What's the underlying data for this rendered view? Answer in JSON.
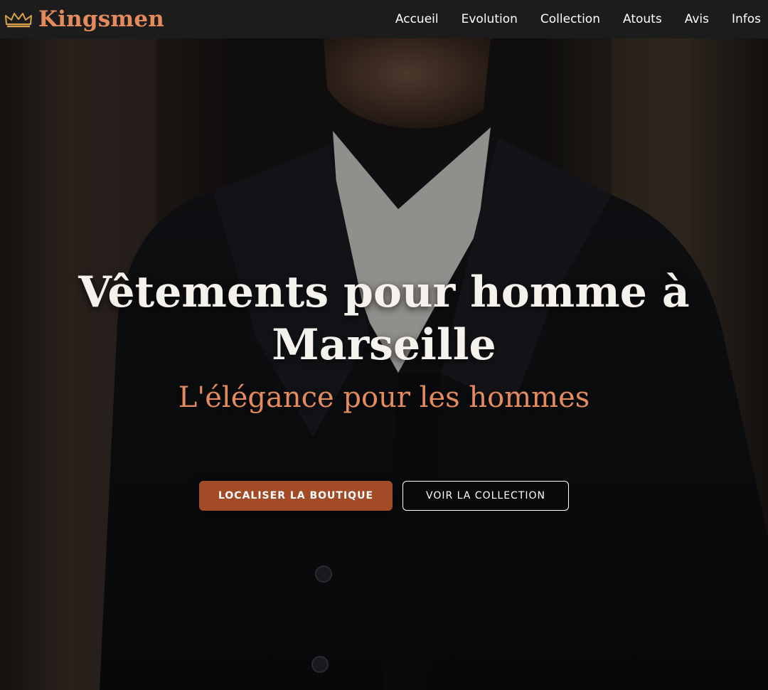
{
  "brand": {
    "name": "Kingsmen",
    "icon": "crown-icon",
    "accent_color": "#e48b5e"
  },
  "nav": {
    "items": [
      {
        "label": "Accueil"
      },
      {
        "label": "Evolution"
      },
      {
        "label": "Collection"
      },
      {
        "label": "Atouts"
      },
      {
        "label": "Avis"
      },
      {
        "label": "Infos"
      }
    ]
  },
  "hero": {
    "title": "Vêtements pour homme à Marseille",
    "subtitle": "L'élégance pour les hommes",
    "primary_button": "LOCALISER LA BOUTIQUE",
    "secondary_button": "VOIR LA COLLECTION",
    "primary_color": "#a24b26"
  }
}
